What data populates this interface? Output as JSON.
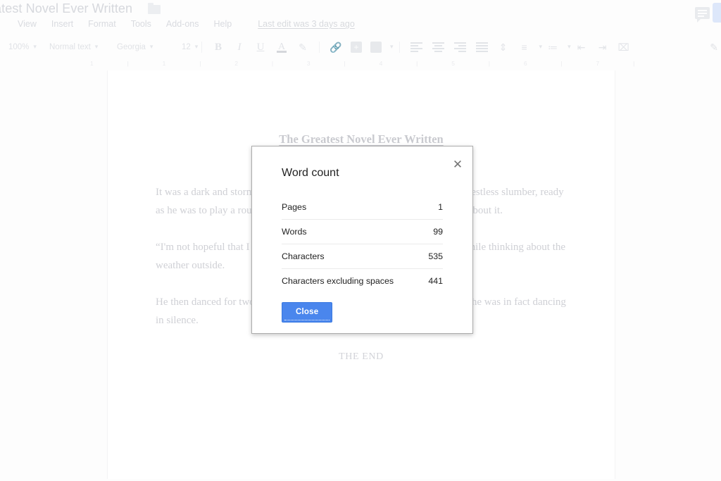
{
  "window": {
    "background_color": "#fdfdfd"
  },
  "titlebar": {
    "document_title": "atest Novel Ever Written",
    "folder_icon": "folder-icon",
    "comment_icon": "comment-bubble-icon",
    "share_button_label": "",
    "menus": [
      {
        "label": "View"
      },
      {
        "label": "Insert"
      },
      {
        "label": "Format"
      },
      {
        "label": "Tools"
      },
      {
        "label": "Add-ons"
      },
      {
        "label": "Help"
      }
    ],
    "last_edit": "Last edit was 3 days ago"
  },
  "toolbar": {
    "zoom": "100%",
    "paragraph_style": "Normal text",
    "font_family": "Georgia",
    "font_size": "12",
    "bold": "B",
    "italic": "I",
    "underline": "U",
    "text_color": "A",
    "highlight_icon": "highlighter-icon",
    "link_icon": "link-icon",
    "comment_icon": "add-comment-icon",
    "image_icon": "insert-image-icon",
    "align_left_icon": "align-left-icon",
    "align_center_icon": "align-center-icon",
    "align_right_icon": "align-right-icon",
    "align_justify_icon": "align-justify-icon",
    "line_spacing_icon": "line-spacing-icon",
    "numbered_list_icon": "numbered-list-icon",
    "bulleted_list_icon": "bulleted-list-icon",
    "decrease_indent_icon": "decrease-indent-icon",
    "increase_indent_icon": "increase-indent-icon",
    "clear_formatting_icon": "clear-formatting-icon",
    "edit_mode_icon": "pencil-icon"
  },
  "ruler": {
    "marks": [
      "1",
      "|",
      "1",
      "|",
      "2",
      "|",
      "3",
      "|",
      "4",
      "|",
      "5",
      "|",
      "6",
      "|",
      "7",
      "|"
    ]
  },
  "document": {
    "heading": "The Greatest Novel Ever Written",
    "paragraphs": [
      "It was a dark and stormy night for the golfer who woke up from his usual restless slumber, ready as he was to play a round of golf that day. He wasn't feeling terribly good about it.",
      "“I'm not hopeful that I will be playing well today,” he said to himself — while thinking about the weather outside.",
      "He then danced for two hours straight, but he forgot to turn on his hi-fi, so he was in fact dancing in silence."
    ],
    "end_text": "THE END"
  },
  "dialog": {
    "title": "Word count",
    "close_icon": "close-icon",
    "rows": [
      {
        "label": "Pages",
        "value": "1"
      },
      {
        "label": "Words",
        "value": "99"
      },
      {
        "label": "Characters",
        "value": "535"
      },
      {
        "label": "Characters excluding spaces",
        "value": "441"
      }
    ],
    "close_button_label": "Close",
    "accent_color": "#4a86ed"
  }
}
